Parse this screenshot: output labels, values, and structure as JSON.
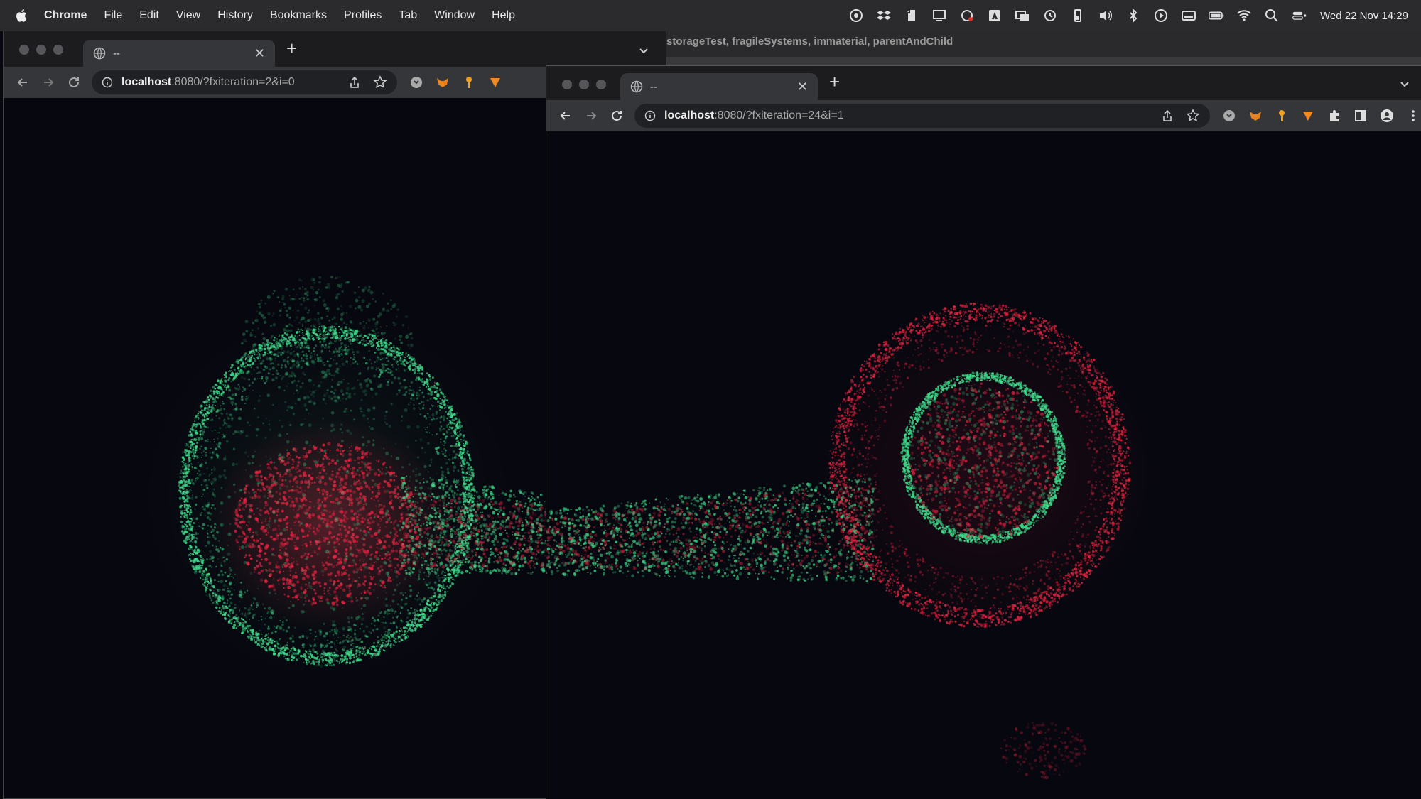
{
  "menubar": {
    "app_name": "Chrome",
    "items": [
      "File",
      "Edit",
      "View",
      "History",
      "Bookmarks",
      "Profiles",
      "Tab",
      "Window",
      "Help"
    ],
    "clock": "Wed 22 Nov  14:29",
    "status_icons": [
      "creative-cloud-icon",
      "dropbox-icon",
      "evernote-icon",
      "display-icon",
      "cloud-sync-icon",
      "adobe-icon",
      "screen-share-icon",
      "time-machine-icon",
      "battery-widget-icon",
      "volume-icon",
      "bluetooth-icon",
      "play-icon",
      "keyboard-icon",
      "battery-icon",
      "wifi-icon",
      "spotlight-search-icon",
      "control-center-icon"
    ]
  },
  "background_window": {
    "title": "storageTest, fragileSystems, immaterial, parentAndChild"
  },
  "window_left": {
    "tab_title": "--",
    "url_host": "localhost",
    "url_rest": ":8080/?fxiteration=2&i=0"
  },
  "window_right": {
    "tab_title": "--",
    "url_host": "localhost",
    "url_rest": ":8080/?fxiteration=24&i=1"
  },
  "colors": {
    "green_particles": "#3fd98a",
    "red_particles": "#e0223f",
    "canvas_bg": "#07070f",
    "chrome_toolbar": "#35363a",
    "menubar_bg": "#2b2b2e"
  }
}
